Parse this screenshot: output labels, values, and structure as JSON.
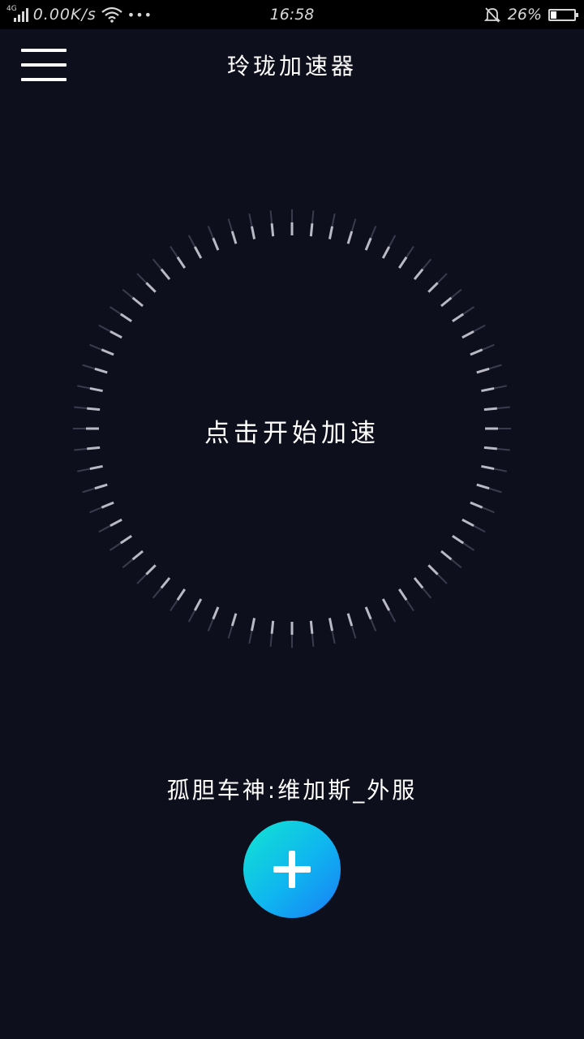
{
  "status_bar": {
    "network_type": "4G",
    "speed": "0.00K/s",
    "more": "•••",
    "time": "16:58",
    "battery_percent_text": "26%",
    "battery_level": 0.26,
    "icons": [
      "signal-icon",
      "wifi-icon",
      "silent-bell-icon",
      "battery-icon"
    ]
  },
  "header": {
    "title": "玲珑加速器",
    "menu_icon": "hamburger-menu-icon"
  },
  "dial": {
    "label": "点击开始加速",
    "tick_count": 64
  },
  "account": {
    "label": "孤胆车神:维加斯_外服"
  },
  "add_button": {
    "icon": "plus-icon"
  },
  "colors": {
    "background": "#0e0f1c",
    "status_bar": "#000000",
    "accent_start": "#12e6d2",
    "accent_end": "#1a7cf6"
  }
}
